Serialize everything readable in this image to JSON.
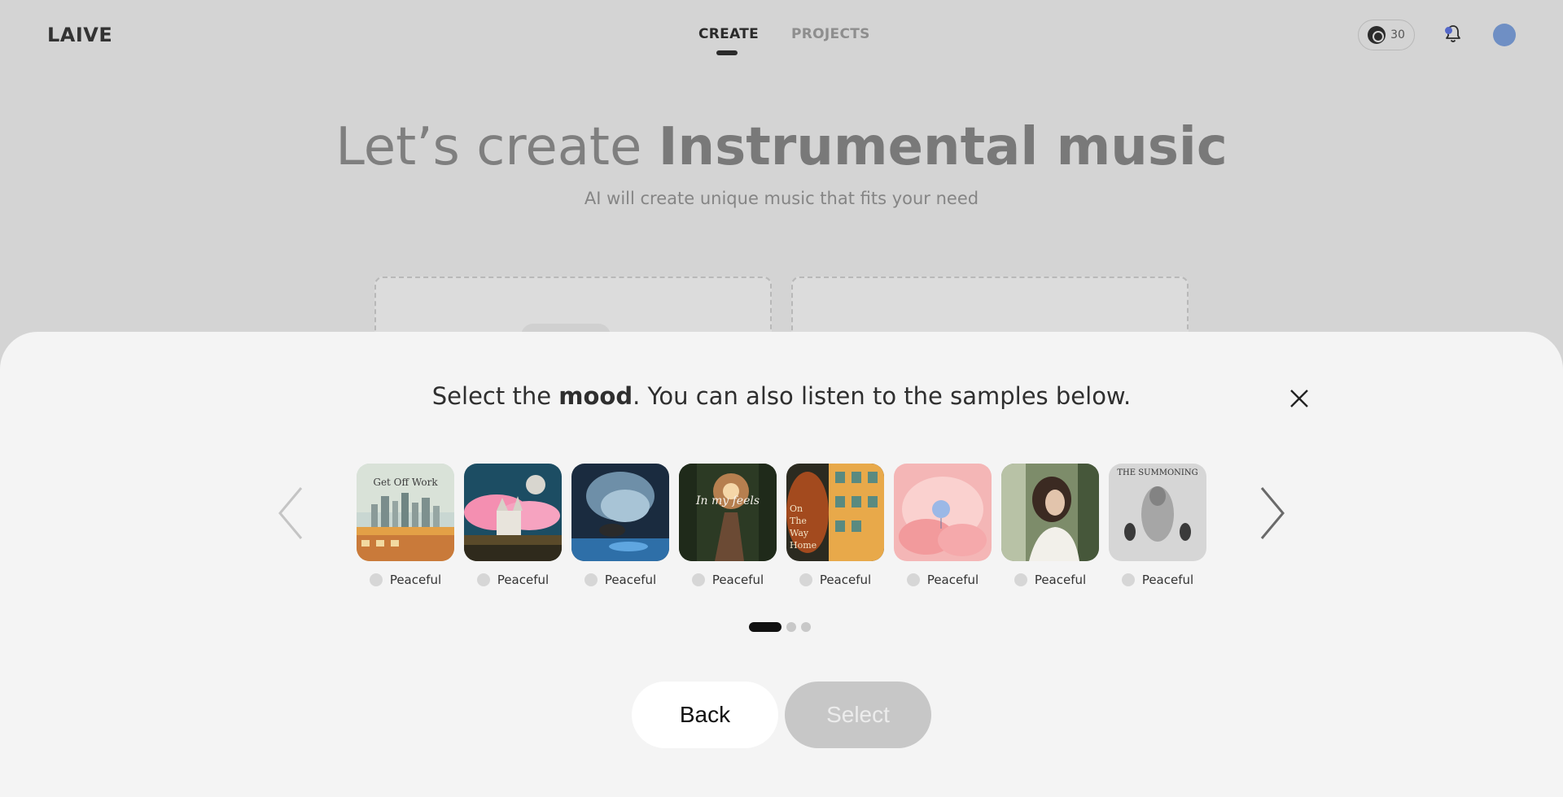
{
  "header": {
    "logo": "LAIVE",
    "tabs": [
      {
        "label": "CREATE",
        "active": true
      },
      {
        "label": "PROJECTS",
        "active": false
      }
    ],
    "credits": "30",
    "icons": [
      "credits-disc-icon",
      "bell-icon",
      "avatar"
    ],
    "accent": "#5468c8"
  },
  "hero": {
    "title_light": "Let’s create ",
    "title_bold": "Instrumental music",
    "subtitle": "AI will create unique music that fits your need"
  },
  "modal": {
    "title_pre": "Select the ",
    "title_bold": "mood",
    "title_post": ". You can also listen to the samples below.",
    "moods": [
      {
        "label": "Peaceful",
        "cover_text": "Get Off Work"
      },
      {
        "label": "Peaceful",
        "cover_text": ""
      },
      {
        "label": "Peaceful",
        "cover_text": ""
      },
      {
        "label": "Peaceful",
        "cover_text": "In my feels"
      },
      {
        "label": "Peaceful",
        "cover_text": "On The Way Home"
      },
      {
        "label": "Peaceful",
        "cover_text": ""
      },
      {
        "label": "Peaceful",
        "cover_text": ""
      },
      {
        "label": "Peaceful",
        "cover_text": "THE SUMMONING"
      }
    ],
    "pagination": {
      "current": 1,
      "total": 3
    },
    "back_label": "Back",
    "select_label": "Select"
  }
}
